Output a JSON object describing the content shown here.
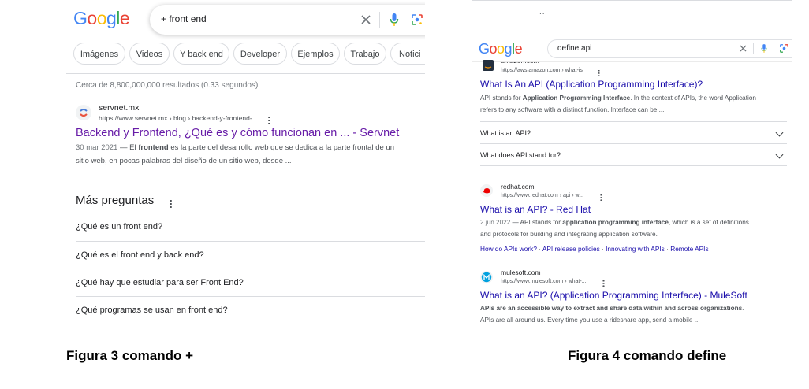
{
  "left": {
    "logo": [
      "G",
      "o",
      "o",
      "g",
      "l",
      "e"
    ],
    "query": "+ front end",
    "chips": [
      "Imágenes",
      "Videos",
      "Y back end",
      "Developer",
      "Ejemplos",
      "Trabajo",
      "Notici"
    ],
    "stats": "Cerca de 8,800,000,000 resultados (0.33 segundos)",
    "result": {
      "site": "servnet.mx",
      "url": "https://www.servnet.mx › blog › backend-y-frontend-...",
      "title": "Backend y Frontend, ¿Qué es y cómo funcionan en ... - Servnet",
      "date": "30 mar 2021",
      "snippet_a": " — El ",
      "snippet_bold": "frontend",
      "snippet_b": " es la parte del desarrollo web que se dedica a la parte frontal de un",
      "snippet_line2": "sitio web, en pocas palabras del diseño de un sitio web, desde ..."
    },
    "more_questions_title": "Más preguntas",
    "questions": [
      "¿Qué es un front end?",
      "¿Qué es el front end y back end?",
      "¿Qué hay que estudiar para ser Front End?",
      "¿Qué programas se usan en front end?"
    ],
    "caption": "Figura 3 comando +"
  },
  "right": {
    "top_dots": "..",
    "logo": [
      "G",
      "o",
      "o",
      "g",
      "l",
      "e"
    ],
    "query": "define api",
    "results": [
      {
        "site": "amazon.com",
        "url": "https://aws.amazon.com › what-is",
        "title": "What Is An API (Application Programming Interface)?",
        "l1_a": "API stands for ",
        "l1_bold": "Application Programming Interface",
        "l1_b": ". In the context of APIs, the word Application",
        "l2": "refers to any software with a distinct function. Interface can be ..."
      },
      {
        "site": "redhat.com",
        "url": "https://www.redhat.com › api › w...",
        "title": "What is an API? - Red Hat",
        "date": "2 jun 2022",
        "l1_a": " — API stands for ",
        "l1_bold": "application programming interface",
        "l1_b": ", which is a set of definitions",
        "l2": "and protocols for building and integrating application software.",
        "sublinks": [
          "How do APIs work?",
          "API release policies",
          "Innovating with APIs",
          "Remote APIs"
        ]
      },
      {
        "site": "mulesoft.com",
        "url": "https://www.mulesoft.com › what-...",
        "title": "What is an API? (Application Programming Interface) - MuleSoft",
        "l1_bold": "APIs are an accessible way to extract and share data within and across organizations",
        "l1_b": ".",
        "l2": "APIs are all around us. Every time you use a rideshare app, send a mobile ..."
      }
    ],
    "questions": [
      "What is an API?",
      "What does API stand for?"
    ],
    "caption": "Figura 4 comando define"
  },
  "colors": {
    "visited_link": "#681da8",
    "link": "#1a0dab",
    "snippet": "#4d5156"
  }
}
